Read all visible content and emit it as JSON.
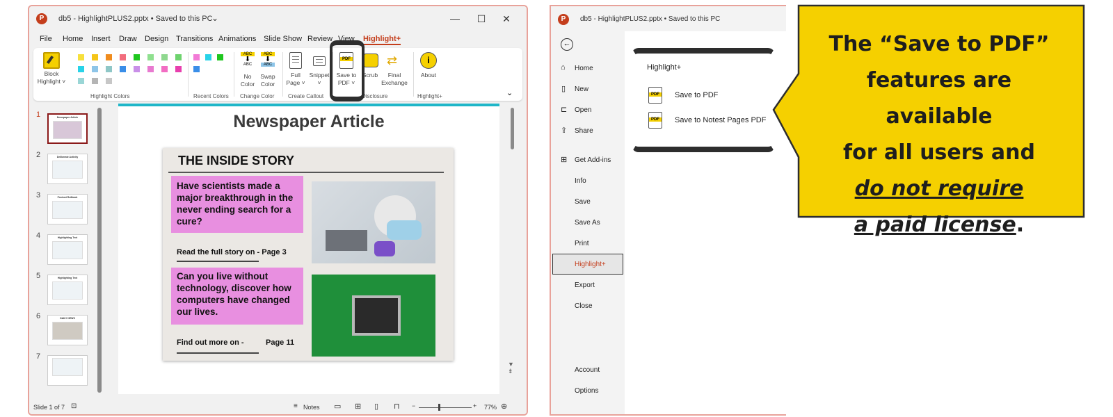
{
  "left_window": {
    "title": "db5 - HighlightPLUS2.pptx • Saved to this PC",
    "title_chevron": "⌄",
    "controls": {
      "minimize": "—",
      "maximize": "☐",
      "close": "✕"
    },
    "menu": [
      "File",
      "Home",
      "Insert",
      "Draw",
      "Design",
      "Transitions",
      "Animations",
      "Slide Show",
      "Review",
      "View",
      "Highlight+"
    ],
    "active_menu": "Highlight+",
    "ribbon": {
      "block_highlight": [
        "Block",
        "Highlight ˅"
      ],
      "no_color": [
        "No",
        "Color"
      ],
      "swap_color": [
        "Swap",
        "Color"
      ],
      "full_page": [
        "Full",
        "Page ˅"
      ],
      "snippet": [
        "Snippet",
        "˅"
      ],
      "save_to_pdf": [
        "Save to",
        "PDF ˅"
      ],
      "scrub": "Scrub",
      "final_exchange": [
        "Final",
        "Exchange"
      ],
      "about": "About",
      "groups": {
        "highlight_colors": "Highlight Colors",
        "recent_colors": "Recent Colors",
        "change_color": "Change Color",
        "create_callout": "Create Callout",
        "disclosure": "Disclosure",
        "highlight_plus": "Highlight+"
      },
      "abc": "ABC",
      "pdf_icon": "PDF",
      "collapse": "⌄",
      "swatches_row1": [
        "#f7e03c",
        "#f5c518",
        "#f08c1e",
        "#f26d7d",
        "#1fc71f",
        "#8fe08f",
        "#8fd88f",
        "#6ed36e"
      ],
      "swatches_row2": [
        "#28d3e8",
        "#8ec5e8",
        "#8fc7c7",
        "#3a8ee8",
        "#c98fe8",
        "#e87ad0",
        "#f26dc3",
        "#e83fae"
      ],
      "swatches_row3": [
        "#9ad6d6",
        "#b5b5b5",
        "#c7c7c7"
      ],
      "recent_row1": [
        "#f27ad6",
        "#28d3e8",
        "#1fc71f"
      ],
      "recent_row2": [
        "#3a8ee8"
      ]
    },
    "thumbnails": [
      "1",
      "2",
      "3",
      "4",
      "5",
      "6",
      "7"
    ],
    "thumb_titles": [
      "Newspaper Article",
      "Deliberate Activity",
      "Product Rollback",
      "Highlighting Text",
      "Highlighting Text",
      "DAILY NEWS",
      ""
    ],
    "slide": {
      "title": "Newspaper Article",
      "headline": "THE INSIDE STORY",
      "story1": "Have scientists made a major breakthrough in the never ending search for a cure?",
      "story1_footer": "Read the full story on -  Page 3",
      "story2": "Can you live without technology, discover how computers have changed our lives.",
      "story2_footer_left": "Find out more on -",
      "story2_footer_right": "Page 11"
    },
    "status": {
      "slide_of": "Slide 1 of 7",
      "notes": "Notes",
      "zoom": "77%",
      "minus": "−",
      "plus": "+"
    }
  },
  "right_window": {
    "title": "db5 - HighlightPLUS2.pptx • Saved to this PC",
    "nav": [
      "Home",
      "New",
      "Open",
      "Share",
      "Get Add-ins",
      "Info",
      "Save",
      "Save As",
      "Print",
      "Highlight+",
      "Export",
      "Close"
    ],
    "nav_bottom": [
      "Account",
      "Options"
    ],
    "active": "Highlight+",
    "panel_title": "Highlight+",
    "options": [
      "Save to PDF",
      "Save to Notest Pages PDF"
    ],
    "pdf_icon": "PDF"
  },
  "callout": {
    "line1": "The “Save to PDF”",
    "line2": "features are available",
    "line3": "for all users and",
    "line4": "do not require",
    "line5": "a paid license",
    "period": ".",
    "fill": "#f5d000"
  }
}
